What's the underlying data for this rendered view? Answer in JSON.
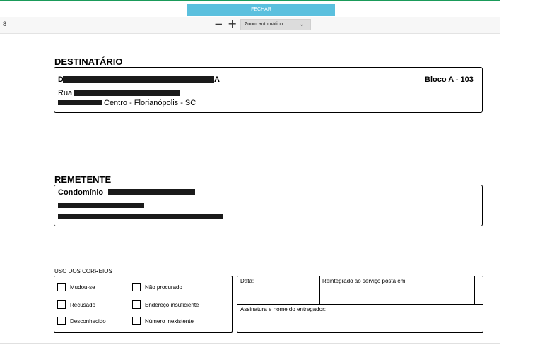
{
  "viewer": {
    "close_label": "FECHAR",
    "page_number": "8",
    "zoom_out_symbol": "−",
    "zoom_in_symbol": "+",
    "zoom_value": "Zoom automático"
  },
  "destinatario": {
    "heading": "DESTINATÁRIO",
    "name_visible_start": "D",
    "name_visible_end": "A",
    "unit": "Bloco A - 103",
    "street_prefix": "Rua",
    "city_line": "Centro  - Florianópolis  - SC"
  },
  "remetente": {
    "heading": "REMETENTE",
    "name_prefix": "Condomínio"
  },
  "correios": {
    "heading": "USO DOS CORREIOS",
    "options": [
      "Mudou-se",
      "Não procurado",
      "Recusado",
      "Endereço insuficiente",
      "Desconhecido",
      "Número inexistente"
    ],
    "date_label": "Data:",
    "reintegrado_label": "Reintegrado ao serviço posta em:",
    "signature_label": "Assinatura e nome do entregador:"
  },
  "colors": {
    "accent_green": "#1a9b5a",
    "close_button": "#5bc0de"
  }
}
